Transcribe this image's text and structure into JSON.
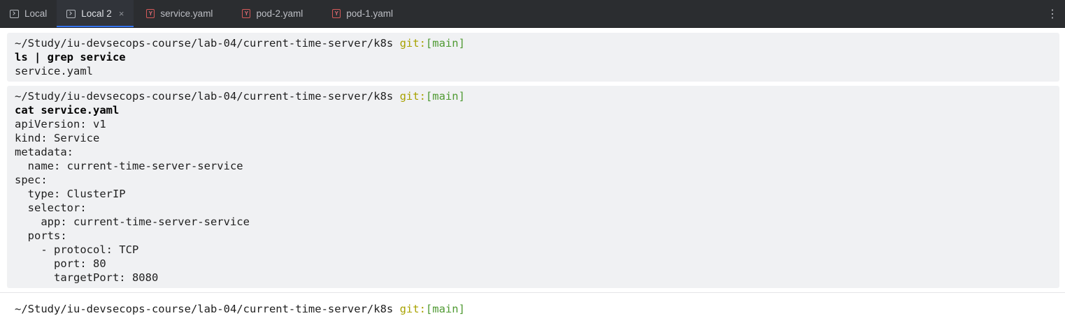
{
  "tabs": [
    {
      "label": "Local",
      "icon": "terminal-icon",
      "active": false
    },
    {
      "label": "Local 2",
      "icon": "terminal-icon",
      "active": true,
      "close": "×"
    },
    {
      "label": "service.yaml",
      "icon": "yaml-file-icon",
      "active": false
    },
    {
      "label": "pod-2.yaml",
      "icon": "yaml-file-icon",
      "active": false
    },
    {
      "label": "pod-1.yaml",
      "icon": "yaml-file-icon",
      "active": false
    }
  ],
  "more_icon": "⋮",
  "prompt": {
    "path": "~/Study/iu-devsecops-course/lab-04/current-time-server/k8s",
    "git": "git:",
    "branch": "[main]"
  },
  "blocks": [
    {
      "command": "ls | grep service",
      "output": [
        "service.yaml"
      ]
    },
    {
      "command": "cat service.yaml",
      "output": [
        "apiVersion: v1",
        "kind: Service",
        "metadata:",
        "  name: current-time-server-service",
        "spec:",
        "  type: ClusterIP",
        "  selector:",
        "    app: current-time-server-service",
        "  ports:",
        "    - protocol: TCP",
        "      port: 80",
        "      targetPort: 8080"
      ]
    }
  ],
  "colors": {
    "tabbar_bg": "#2b2d30",
    "block_bg": "#f0f1f3",
    "git": "#a8a200",
    "branch": "#4f9a32",
    "accent": "#3574f0"
  }
}
